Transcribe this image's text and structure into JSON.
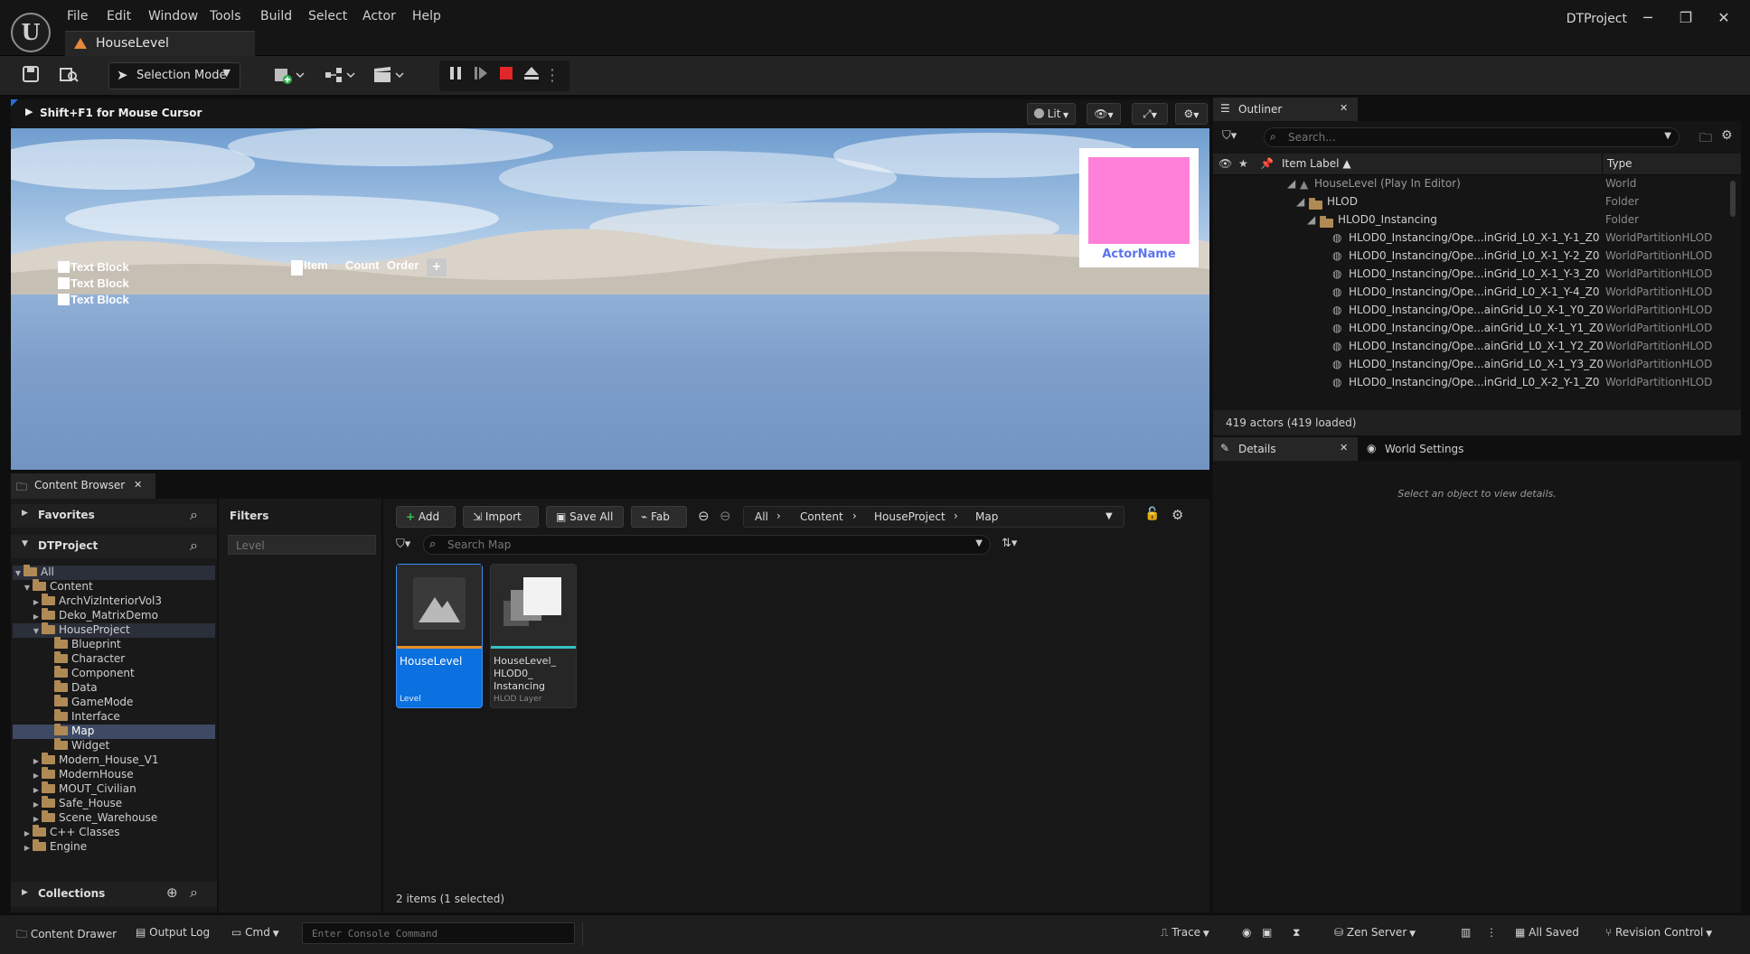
{
  "app": {
    "project_title": "DTProject",
    "menu": [
      "File",
      "Edit",
      "Window",
      "Tools",
      "Build",
      "Select",
      "Actor",
      "Help"
    ],
    "level_tab": "HouseLevel"
  },
  "toolbar": {
    "selection_mode": "Selection Mode"
  },
  "viewport": {
    "hint": "Shift+F1 for Mouse Cursor",
    "lit_label": "Lit",
    "text_blocks": [
      "Text Block",
      "Text Block",
      "Text Block"
    ],
    "inventory_headers": {
      "item": "Item",
      "count": "Count",
      "order": "Order"
    },
    "add_button": "+",
    "actor_name": "ActorName",
    "actor_color": "#ff80d8"
  },
  "outliner": {
    "tab": "Outliner",
    "search_placeholder": "Search...",
    "col_label": "Item Label",
    "col_type": "Type",
    "rows": [
      {
        "label": "HouseLevel (Play In Editor)",
        "type": "World"
      },
      {
        "label": "HLOD",
        "type": "Folder"
      },
      {
        "label": "HLOD0_Instancing",
        "type": "Folder"
      },
      {
        "label": "HLOD0_Instancing/Ope...inGrid_L0_X-1_Y-1_Z0",
        "type": "WorldPartitionHLOD"
      },
      {
        "label": "HLOD0_Instancing/Ope...inGrid_L0_X-1_Y-2_Z0",
        "type": "WorldPartitionHLOD"
      },
      {
        "label": "HLOD0_Instancing/Ope...inGrid_L0_X-1_Y-3_Z0",
        "type": "WorldPartitionHLOD"
      },
      {
        "label": "HLOD0_Instancing/Ope...inGrid_L0_X-1_Y-4_Z0",
        "type": "WorldPartitionHLOD"
      },
      {
        "label": "HLOD0_Instancing/Ope...ainGrid_L0_X-1_Y0_Z0",
        "type": "WorldPartitionHLOD"
      },
      {
        "label": "HLOD0_Instancing/Ope...ainGrid_L0_X-1_Y1_Z0",
        "type": "WorldPartitionHLOD"
      },
      {
        "label": "HLOD0_Instancing/Ope...ainGrid_L0_X-1_Y2_Z0",
        "type": "WorldPartitionHLOD"
      },
      {
        "label": "HLOD0_Instancing/Ope...ainGrid_L0_X-1_Y3_Z0",
        "type": "WorldPartitionHLOD"
      },
      {
        "label": "HLOD0_Instancing/Ope...inGrid_L0_X-2_Y-1_Z0",
        "type": "WorldPartitionHLOD"
      }
    ],
    "status": "419 actors (419 loaded)"
  },
  "details": {
    "tab": "Details",
    "world_settings_tab": "World Settings",
    "hint": "Select an object to view details."
  },
  "content_browser": {
    "tab": "Content Browser",
    "favorites": "Favorites",
    "project": "DTProject",
    "tree": [
      {
        "label": "All",
        "caret": "down"
      },
      {
        "label": "Content",
        "caret": "down"
      },
      {
        "label": "ArchVizInteriorVol3",
        "caret": "right"
      },
      {
        "label": "Deko_MatrixDemo",
        "caret": "right"
      },
      {
        "label": "HouseProject",
        "caret": "down"
      },
      {
        "label": "Blueprint",
        "caret": ""
      },
      {
        "label": "Character",
        "caret": ""
      },
      {
        "label": "Component",
        "caret": ""
      },
      {
        "label": "Data",
        "caret": ""
      },
      {
        "label": "GameMode",
        "caret": ""
      },
      {
        "label": "Interface",
        "caret": ""
      },
      {
        "label": "Map",
        "caret": ""
      },
      {
        "label": "Widget",
        "caret": ""
      },
      {
        "label": "Modern_House_V1",
        "caret": "right"
      },
      {
        "label": "ModernHouse",
        "caret": "right"
      },
      {
        "label": "MOUT_Civilian",
        "caret": "right"
      },
      {
        "label": "Safe_House",
        "caret": "right"
      },
      {
        "label": "Scene_Warehouse",
        "caret": "right"
      },
      {
        "label": "C++ Classes",
        "caret": "right"
      },
      {
        "label": "Engine",
        "caret": "right"
      }
    ],
    "collections": "Collections",
    "filters": "Filters",
    "filter_placeholder": "Level",
    "buttons": {
      "add": "Add",
      "import": "Import",
      "save_all": "Save All",
      "fab": "Fab"
    },
    "breadcrumb": [
      "All",
      "Content",
      "HouseProject",
      "Map"
    ],
    "search_placeholder": "Search Map",
    "assets": [
      {
        "name": "HouseLevel",
        "kind": "Level",
        "selected": true
      },
      {
        "name": "HouseLevel_ HLOD0_ Instancing",
        "kind": "HLOD Layer",
        "selected": false
      }
    ],
    "item_count": "2 items (1 selected)"
  },
  "statusbar": {
    "content_drawer": "Content Drawer",
    "output_log": "Output Log",
    "cmd": "Cmd",
    "console_placeholder": "Enter Console Command",
    "trace": "Trace",
    "zen_server": "Zen Server",
    "all_saved": "All Saved",
    "revision_control": "Revision Control"
  }
}
